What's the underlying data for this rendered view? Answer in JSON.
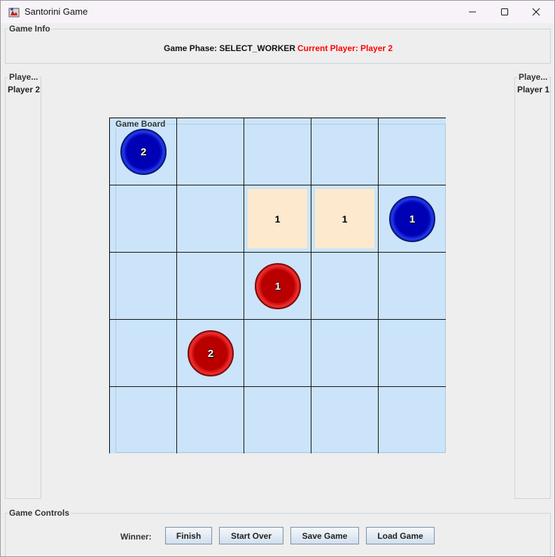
{
  "window": {
    "title": "Santorini Game"
  },
  "game_info": {
    "group_title": "Game Info",
    "phase_label": "Game Phase: SELECT_WORKER",
    "current_player_label": "Current Player: Player 2",
    "current_player_color": "#ff0000"
  },
  "left_panel": {
    "group_title": "Playe...",
    "player_name": "Player 2"
  },
  "right_panel": {
    "group_title": "Playe...",
    "player_name": "Player 1"
  },
  "board": {
    "title": "Game Board",
    "rows": 5,
    "cols": 5,
    "cell_color": "#cbe4fa",
    "building_color": "#fde9cd",
    "buildings": [
      {
        "row": 1,
        "col": 2,
        "level": "1"
      },
      {
        "row": 1,
        "col": 3,
        "level": "1"
      }
    ],
    "workers": [
      {
        "row": 0,
        "col": 0,
        "label": "2",
        "color": "blue"
      },
      {
        "row": 1,
        "col": 4,
        "label": "1",
        "color": "blue"
      },
      {
        "row": 2,
        "col": 2,
        "label": "1",
        "color": "red"
      },
      {
        "row": 3,
        "col": 1,
        "label": "2",
        "color": "red"
      }
    ]
  },
  "controls": {
    "group_title": "Game Controls",
    "winner_label": "Winner:",
    "finish_label": "Finish",
    "start_over_label": "Start Over",
    "save_label": "Save Game",
    "load_label": "Load Game"
  },
  "icons": {
    "app": "santorini-app-icon",
    "minimize": "minimize-icon",
    "maximize": "maximize-icon",
    "close": "close-icon"
  }
}
